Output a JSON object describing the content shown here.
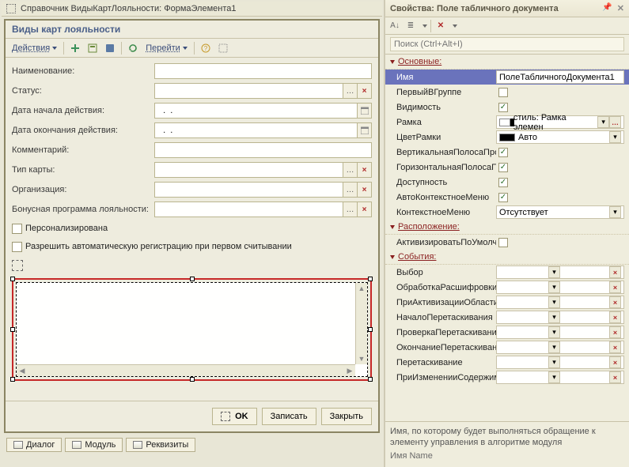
{
  "outer_title": "Справочник ВидыКартЛояльности: ФормаЭлемента1",
  "form_title": "Виды карт лояльности",
  "toolbar": {
    "actions_label": "Действия",
    "goto_label": "Перейти"
  },
  "fields": [
    {
      "label": "Наименование:",
      "value": "",
      "btns": []
    },
    {
      "label": "Статус:",
      "value": "",
      "btns": [
        "...",
        "x"
      ]
    },
    {
      "label": "Дата начала действия:",
      "value": "  .  .",
      "btns": [
        "cal"
      ]
    },
    {
      "label": "Дата окончания действия:",
      "value": "  .  .",
      "btns": [
        "cal"
      ]
    },
    {
      "label": "Комментарий:",
      "value": "",
      "btns": []
    },
    {
      "label": "Тип карты:",
      "value": "",
      "btns": [
        "...",
        "x"
      ]
    },
    {
      "label": "Организация:",
      "value": "",
      "btns": [
        "...",
        "x"
      ]
    },
    {
      "label": "Бонусная программа лояльности:",
      "value": "",
      "btns": [
        "...",
        "x"
      ]
    }
  ],
  "checks": [
    "Персонализирована",
    "Разрешить автоматическую регистрацию при первом считывании"
  ],
  "buttons": {
    "ok": "OK",
    "save": "Записать",
    "close": "Закрыть"
  },
  "tabs": [
    "Диалог",
    "Модуль",
    "Реквизиты"
  ],
  "props": {
    "title": "Свойства: Поле табличного документа",
    "search_placeholder": "Поиск (Ctrl+Alt+I)",
    "sections": {
      "main": "Основные:",
      "layout": "Расположение:",
      "events": "События:"
    },
    "main": {
      "name_label": "Имя",
      "name_value": "ПолеТабличногоДокумента1",
      "first_in_group": "ПервыйВГруппе",
      "visible": "Видимость",
      "frame": "Рамка",
      "frame_value": "стиль: Рамка элемен",
      "frame_color": "ЦветРамки",
      "frame_color_value": "Авто",
      "vscroll": "ВертикальнаяПолосаПро",
      "hscroll": "ГоризонтальнаяПолосаП",
      "enabled": "Доступность",
      "autoctx": "АвтоКонтекстноеМеню",
      "ctxmenu": "КонтекстноеМеню",
      "ctxmenu_value": "Отсутствует"
    },
    "layout": {
      "activate_default": "АктивизироватьПоУмолчанию"
    },
    "events": [
      "Выбор",
      "ОбработкаРасшифровки",
      "ПриАктивизацииОбласти",
      "НачалоПеретаскивания",
      "ПроверкаПеретаскивани",
      "ОкончаниеПеретаскиван",
      "Перетаскивание",
      "ПриИзмененииСодержим"
    ],
    "hint": "Имя, по которому будет выполняться обращение к элементу управления в алгоритме модуля",
    "hint_path": "Имя  Name"
  }
}
